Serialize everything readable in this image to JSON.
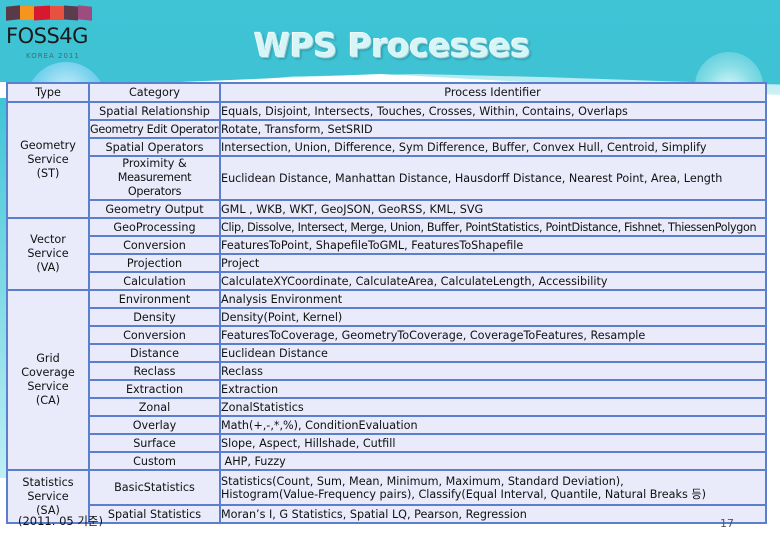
{
  "logo": {
    "name": "FOSS4G",
    "subtitle": "KOREA 2011",
    "block_colors": [
      "#5a3a47",
      "#f7941d",
      "#d7192f",
      "#e8503f",
      "#5b3c4c",
      "#9e4b7f"
    ]
  },
  "title": "WPS Processes",
  "table": {
    "headers": {
      "type": "Type",
      "category": "Category",
      "process": "Process Identifier"
    },
    "groups": [
      {
        "type": "Geometry Service (ST)",
        "rows": [
          {
            "category": "Spatial Relationship",
            "process": "Equals, Disjoint, Intersects, Touches, Crosses, Within, Contains, Overlaps"
          },
          {
            "category": "Geometry Edit Operators",
            "process": "Rotate, Transform, SetSRID"
          },
          {
            "category": "Spatial Operators",
            "process": "Intersection, Union, Difference, Sym Difference, Buffer, Convex Hull, Centroid, Simplify"
          },
          {
            "category": "Proximity & Measurement Operators",
            "process": "Euclidean Distance, Manhattan Distance, Hausdorff Distance, Nearest Point, Area, Length"
          },
          {
            "category": "Geometry Output",
            "process": "GML , WKB, WKT, GeoJSON, GeoRSS, KML, SVG"
          }
        ]
      },
      {
        "type": "Vector Service (VA)",
        "rows": [
          {
            "category": "GeoProcessing",
            "process": "Clip, Dissolve, Intersect, Merge, Union, Buffer, PointStatistics, PointDistance, Fishnet, ThiessenPolygon"
          },
          {
            "category": "Conversion",
            "process": "FeaturesToPoint, ShapefileToGML, FeaturesToShapefile"
          },
          {
            "category": "Projection",
            "process": "Project"
          },
          {
            "category": "Calculation",
            "process": "CalculateXYCoordinate, CalculateArea, CalculateLength, Accessibility"
          }
        ]
      },
      {
        "type": "Grid Coverage Service (CA)",
        "rows": [
          {
            "category": "Environment",
            "process": "Analysis Environment"
          },
          {
            "category": "Density",
            "process": "Density(Point, Kernel)"
          },
          {
            "category": "Conversion",
            "process": "FeaturesToCoverage, GeometryToCoverage, CoverageToFeatures, Resample"
          },
          {
            "category": "Distance",
            "process": "Euclidean Distance"
          },
          {
            "category": "Reclass",
            "process": "Reclass"
          },
          {
            "category": "Extraction",
            "process": "Extraction"
          },
          {
            "category": "Zonal",
            "process": "ZonalStatistics"
          },
          {
            "category": "Overlay",
            "process": "Math(+,-,*,%), ConditionEvaluation"
          },
          {
            "category": "Surface",
            "process": "Slope, Aspect, Hillshade, Cutfill"
          },
          {
            "category": "Custom",
            "process": " AHP, Fuzzy"
          }
        ]
      },
      {
        "type": "Statistics Service (SA)",
        "rows": [
          {
            "category": "BasicStatistics",
            "process": "Statistics(Count, Sum, Mean, Minimum, Maximum, Standard Deviation), Histogram(Value-Frequency pairs), Classify(Equal Interval, Quantile, Natural Breaks 등)"
          },
          {
            "category": "Spatial Statistics",
            "process": "Moran’s I, G Statistics, Spatial LQ, Pearson, Regression"
          }
        ]
      }
    ],
    "type_lines": {
      "geometry": [
        "Geometry",
        "Service",
        "(ST)"
      ],
      "vector": [
        "Vector",
        "Service",
        "(VA)"
      ],
      "grid": [
        "Grid",
        "Coverage",
        "Service",
        "(CA)"
      ],
      "stats": [
        "Statistics",
        "Service",
        "(SA)"
      ]
    },
    "proximity_lines": [
      "Proximity &",
      "Measurement Operators"
    ],
    "basic_stats_lines": [
      "Statistics(Count, Sum, Mean, Minimum, Maximum, Standard Deviation),",
      "Histogram(Value-Frequency pairs), Classify(Equal Interval, Quantile, Natural Breaks 등)"
    ]
  },
  "footnote": "(2011. 05 기준)",
  "page_number": "17"
}
